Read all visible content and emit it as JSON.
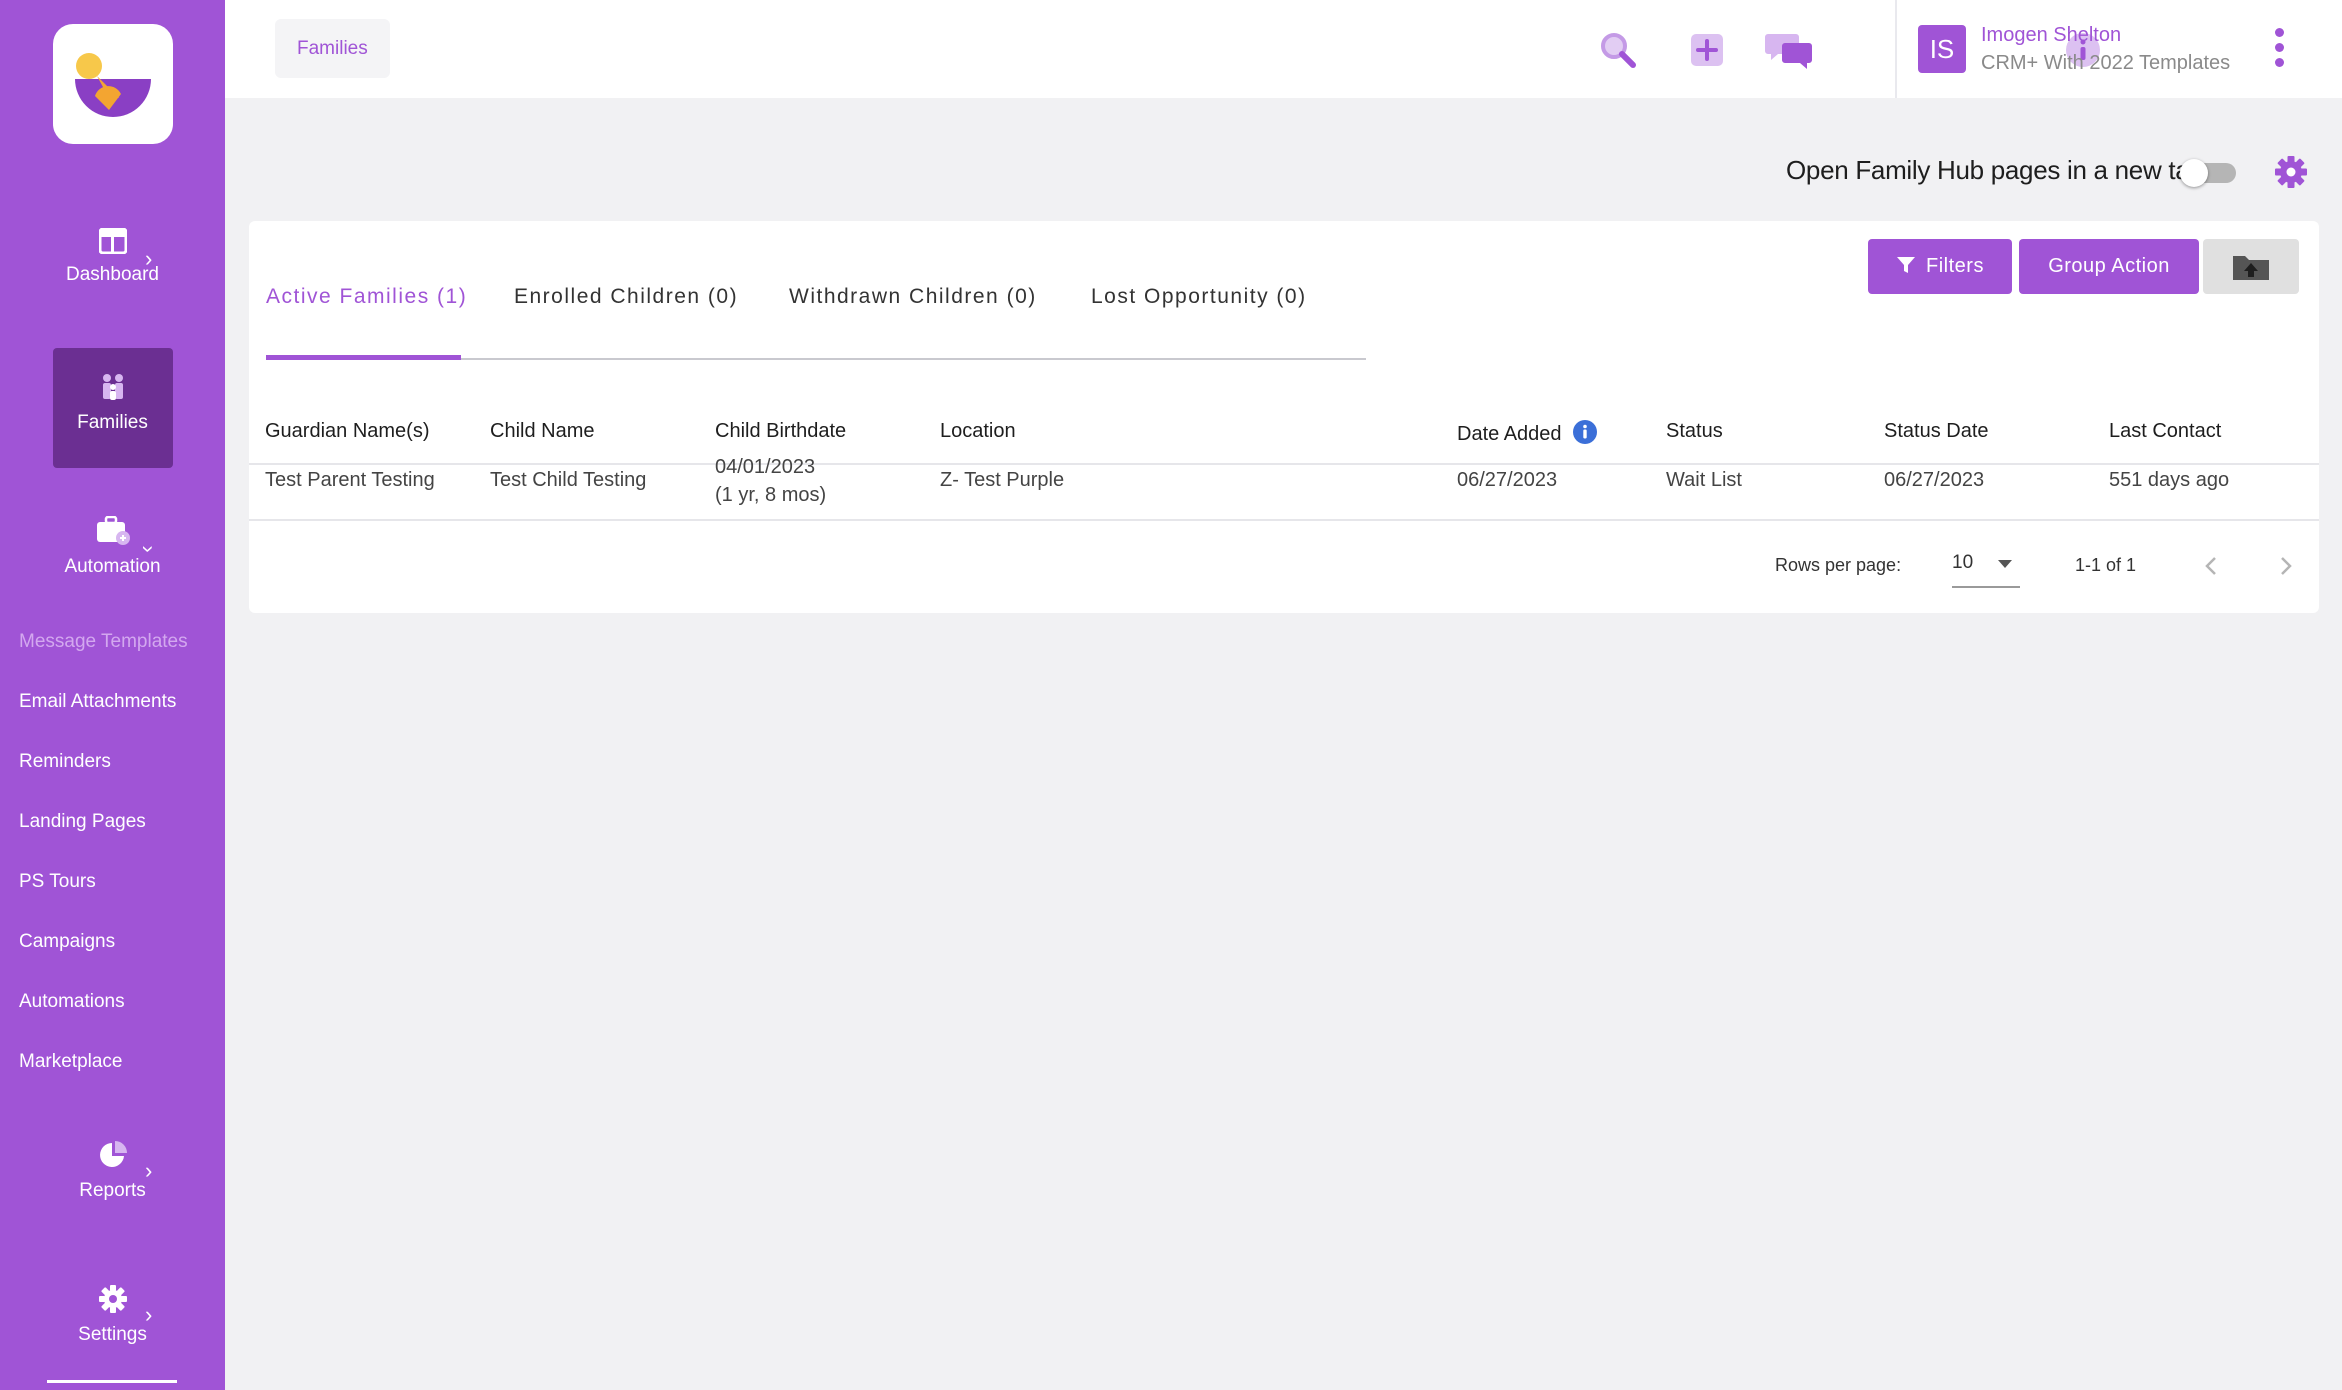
{
  "sidebar": {
    "nav": [
      {
        "label": "Dashboard",
        "icon": "dashboard-icon"
      },
      {
        "label": "Families",
        "icon": "families-icon",
        "active": true
      },
      {
        "label": "Automation",
        "icon": "automation-icon"
      },
      {
        "label": "Reports",
        "icon": "pie-chart-icon"
      },
      {
        "label": "Settings",
        "icon": "gear-icon"
      }
    ],
    "automation_items": [
      "Message Templates",
      "Email Attachments",
      "Reminders",
      "Landing Pages",
      "PS Tours",
      "Campaigns",
      "Automations",
      "Marketplace"
    ]
  },
  "header": {
    "breadcrumb": "Families",
    "user": {
      "initials": "IS",
      "name": "Imogen Shelton",
      "plan": "CRM+ With 2022 Templates"
    }
  },
  "toolbar": {
    "toggle_label": "Open Family Hub pages in a new tab",
    "toggle_on": false
  },
  "tabs": [
    {
      "label": "Active Families (1)",
      "active": true
    },
    {
      "label": "Enrolled Children (0)"
    },
    {
      "label": "Withdrawn Children (0)"
    },
    {
      "label": "Lost Opportunity (0)"
    }
  ],
  "actions": {
    "filters": "Filters",
    "group_action": "Group Action"
  },
  "table": {
    "columns": [
      "Guardian Name(s)",
      "Child Name",
      "Child Birthdate",
      "Location",
      "Date Added",
      "Status",
      "Status Date",
      "Last Contact"
    ],
    "rows": [
      {
        "guardian": "Test Parent Testing",
        "child": "Test Child Testing",
        "birthdate": "04/01/2023",
        "age": "(1 yr, 8 mos)",
        "location": "Z- Test Purple",
        "date_added": "06/27/2023",
        "status": "Wait List",
        "status_date": "06/27/2023",
        "last_contact": "551 days ago"
      }
    ]
  },
  "pagination": {
    "rows_label": "Rows per page:",
    "rows_value": "10",
    "range": "1-1 of 1"
  },
  "colors": {
    "brand": "#a054d6",
    "brand_dark": "#6b2f92",
    "info_blue": "#3b6fd8"
  }
}
